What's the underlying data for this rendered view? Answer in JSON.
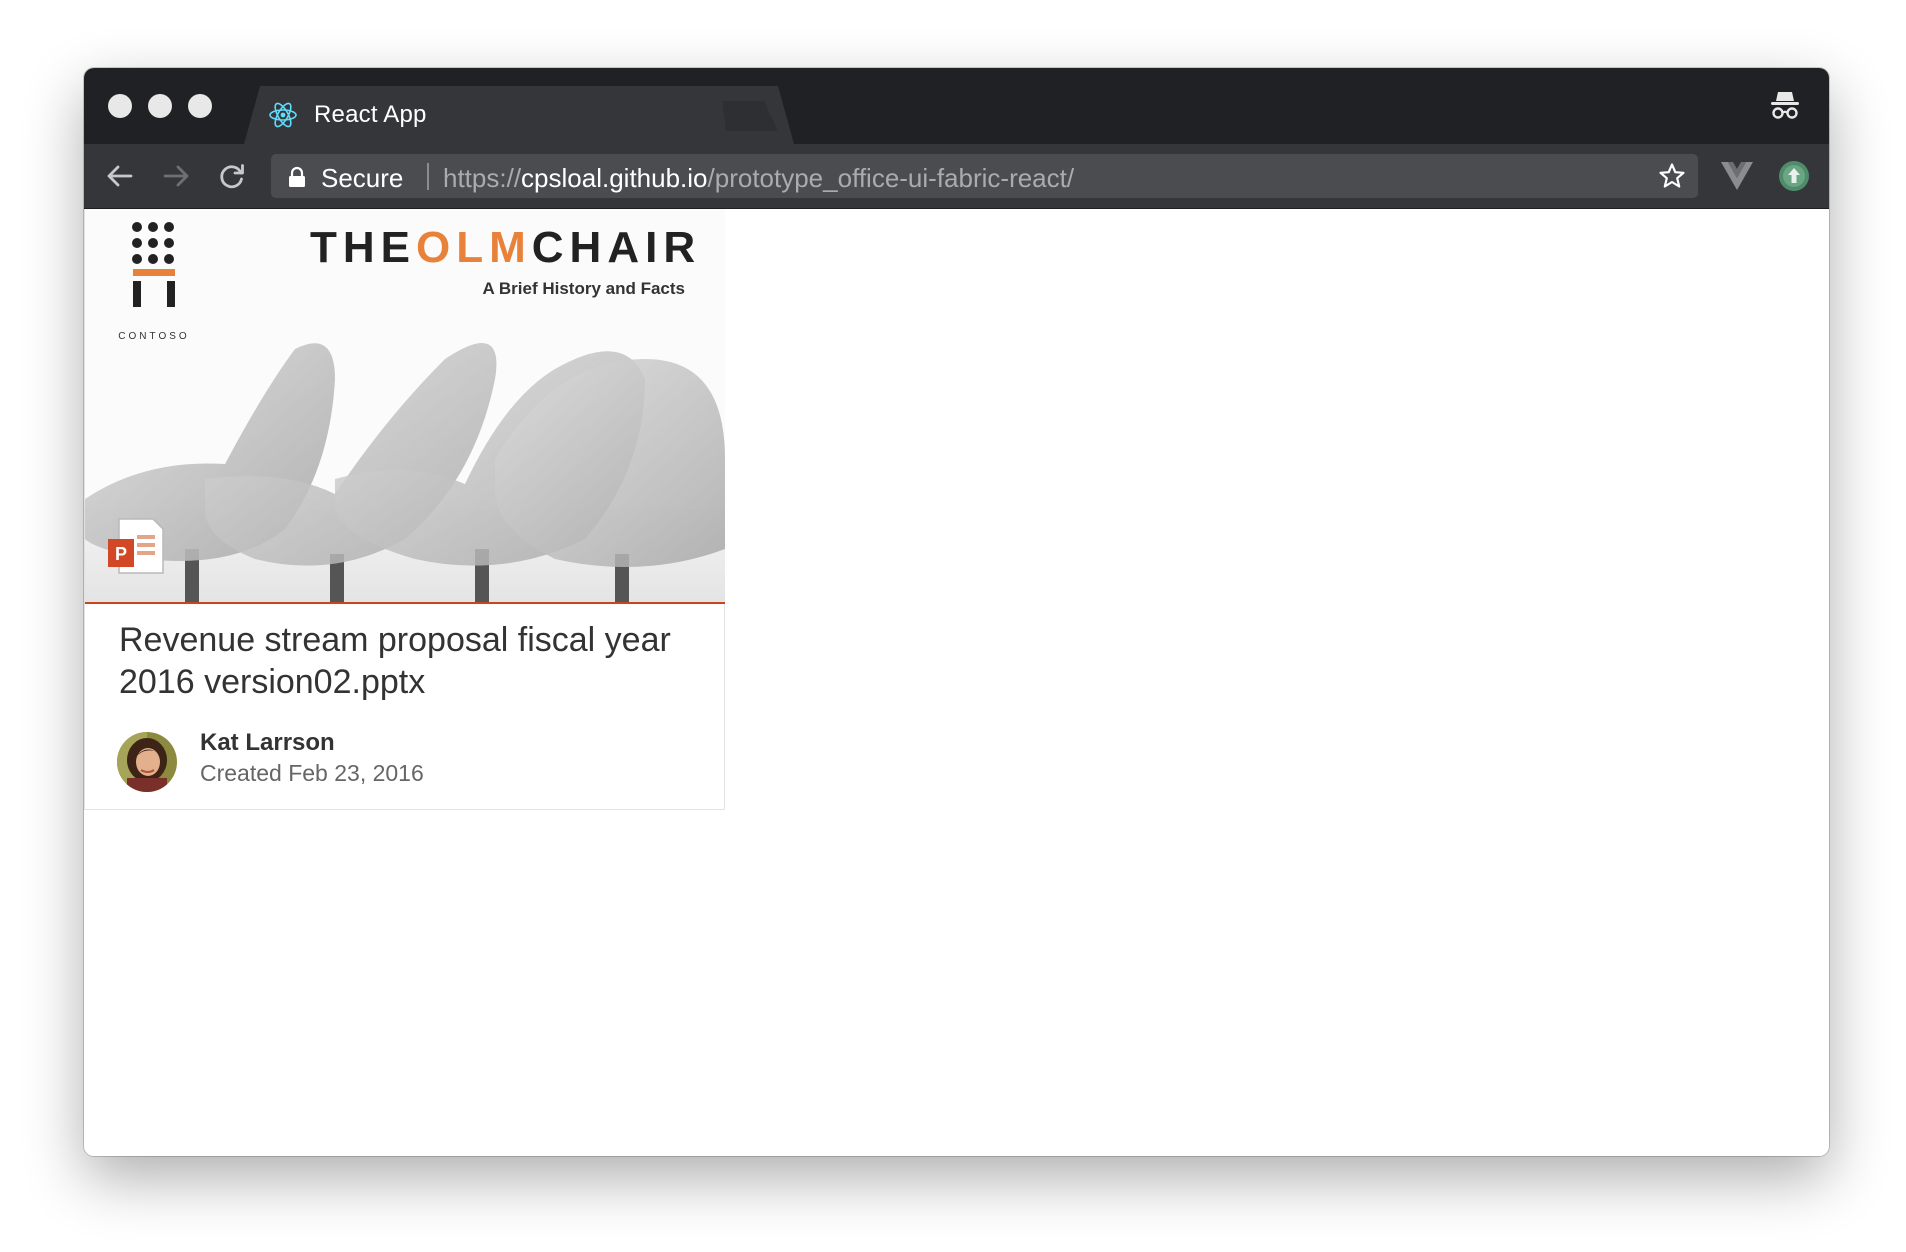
{
  "browser": {
    "tab": {
      "title": "React App",
      "close_glyph": "×",
      "icon": "react-logo-icon"
    },
    "omnibox": {
      "security_label": "Secure",
      "url_scheme": "https://",
      "url_host": "cpsloal.github.io",
      "url_path": "/prototype_office-ui-fabric-react/"
    },
    "icons": [
      "back-arrow-icon",
      "forward-arrow-icon",
      "reload-icon",
      "lock-icon",
      "star-icon",
      "vue-devtools-icon",
      "extension-upload-icon",
      "incognito-icon"
    ]
  },
  "document_card": {
    "preview": {
      "brand": {
        "the": "THE",
        "olm": "OLM",
        "chair": "CHAIR"
      },
      "subtitle": "A Brief History and Facts",
      "logo_caption": "CONTOSO",
      "file_type_badge": "P",
      "accent_color": "#c7451f"
    },
    "title": "Revenue stream proposal fiscal year 2016 version02.pptx",
    "author": "Kat Larrson",
    "activity": "Created Feb 23, 2016"
  },
  "colors": {
    "titlebar": "#202124",
    "toolbar": "#34363a",
    "omnibox": "#4a4c50",
    "brand_orange": "#e8823a"
  }
}
